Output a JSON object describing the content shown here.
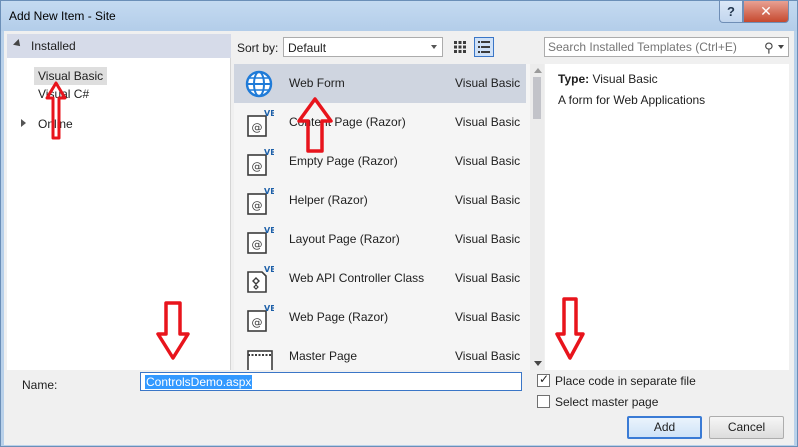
{
  "window": {
    "title": "Add New Item - Site",
    "help_label": "?",
    "close_label": "✕"
  },
  "left": {
    "installed_label": "Installed",
    "items": [
      {
        "label": "Visual Basic",
        "selected": true
      },
      {
        "label": "Visual C#",
        "selected": false
      },
      {
        "label": "Online",
        "selected": false
      }
    ]
  },
  "toolbar": {
    "sort_label": "Sort by:",
    "sort_value": "Default",
    "search_placeholder": "Search Installed Templates (Ctrl+E)"
  },
  "templates": [
    {
      "name": "Web Form",
      "lang": "Visual Basic",
      "icon": "globe-icon",
      "selected": true
    },
    {
      "name": "Content Page (Razor)",
      "lang": "Visual Basic",
      "icon": "vb-razor-icon",
      "selected": false
    },
    {
      "name": "Empty Page (Razor)",
      "lang": "Visual Basic",
      "icon": "vb-razor-icon",
      "selected": false
    },
    {
      "name": "Helper (Razor)",
      "lang": "Visual Basic",
      "icon": "vb-razor-icon",
      "selected": false
    },
    {
      "name": "Layout Page (Razor)",
      "lang": "Visual Basic",
      "icon": "vb-razor-icon",
      "selected": false
    },
    {
      "name": "Web API Controller Class",
      "lang": "Visual Basic",
      "icon": "vb-class-icon",
      "selected": false
    },
    {
      "name": "Web Page (Razor)",
      "lang": "Visual Basic",
      "icon": "vb-razor-icon",
      "selected": false
    },
    {
      "name": "Master Page",
      "lang": "Visual Basic",
      "icon": "master-page-icon",
      "selected": false
    }
  ],
  "details": {
    "type_label": "Type:",
    "type_value": "Visual Basic",
    "description": "A form for Web Applications"
  },
  "bottom": {
    "name_label": "Name:",
    "name_value": "ControlsDemo.aspx",
    "separate_file_label": "Place code in separate file",
    "separate_file_checked": true,
    "master_page_label": "Select master page",
    "master_page_checked": false,
    "add_label": "Add",
    "cancel_label": "Cancel"
  },
  "colors": {
    "annotation": "#e8141c",
    "accent": "#3a76c7"
  }
}
